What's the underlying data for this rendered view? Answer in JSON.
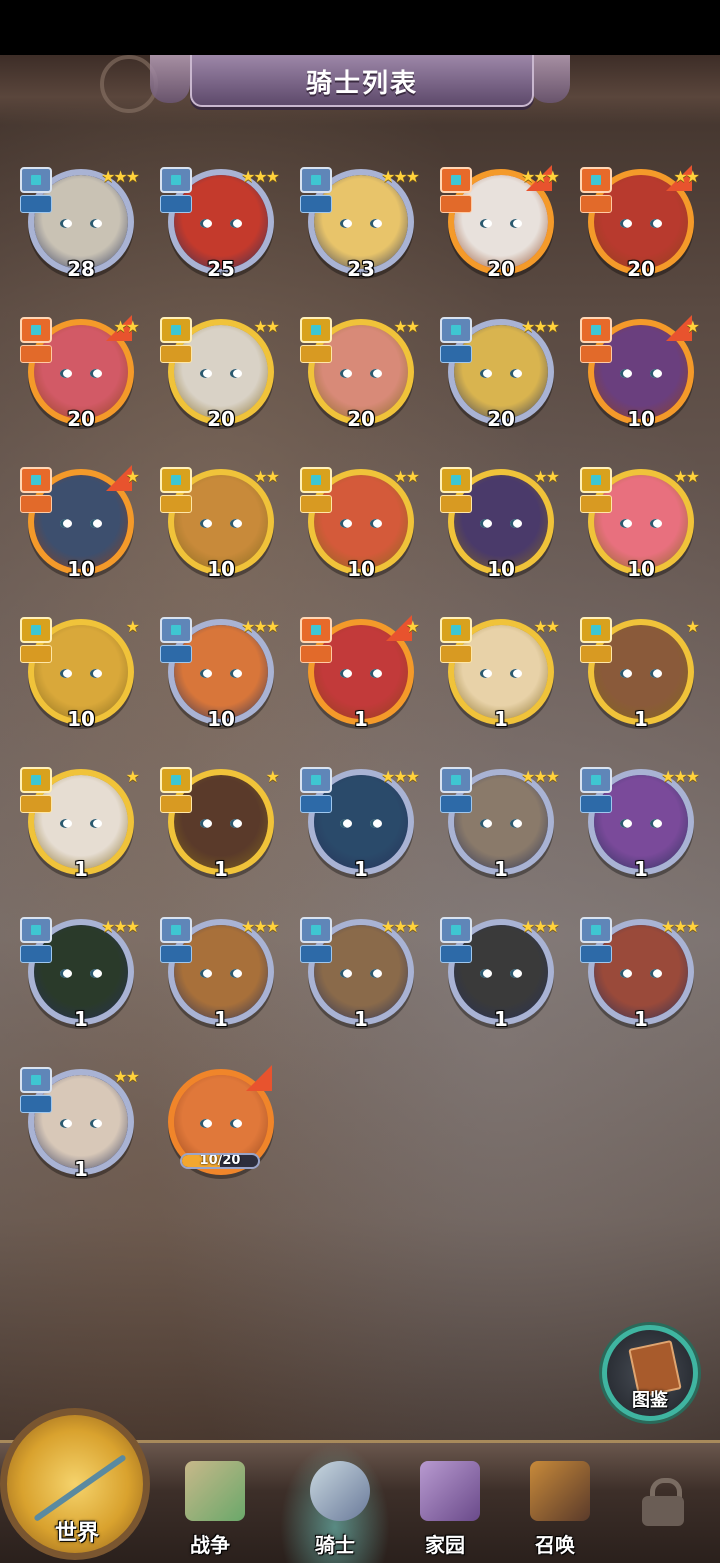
{
  "header": {
    "title": "骑士列表"
  },
  "knights": [
    {
      "level": "28",
      "stars": "★★★",
      "rarity": "blue",
      "flag": false,
      "face": "#c9c2b4"
    },
    {
      "level": "25",
      "stars": "★★★",
      "rarity": "blue",
      "flag": false,
      "face": "#c43a2c"
    },
    {
      "level": "23",
      "stars": "★★★",
      "rarity": "blue",
      "flag": false,
      "face": "#e8c46a"
    },
    {
      "level": "20",
      "stars": "★★★",
      "rarity": "orange",
      "flag": true,
      "face": "#e8e1dc"
    },
    {
      "level": "20",
      "stars": "★★",
      "rarity": "orange",
      "flag": true,
      "face": "#b83a2e"
    },
    {
      "level": "20",
      "stars": "★★",
      "rarity": "orange",
      "flag": true,
      "face": "#d25a66"
    },
    {
      "level": "20",
      "stars": "★★",
      "rarity": "gold",
      "flag": false,
      "face": "#d9d2c6"
    },
    {
      "level": "20",
      "stars": "★★",
      "rarity": "gold",
      "flag": false,
      "face": "#d88a78"
    },
    {
      "level": "20",
      "stars": "★★★",
      "rarity": "blue",
      "flag": false,
      "face": "#d9b44f"
    },
    {
      "level": "10",
      "stars": "★",
      "rarity": "orange",
      "flag": true,
      "face": "#6a3f7e"
    },
    {
      "level": "10",
      "stars": "★",
      "rarity": "orange",
      "flag": true,
      "face": "#3d4f6e"
    },
    {
      "level": "10",
      "stars": "★★",
      "rarity": "gold",
      "flag": false,
      "face": "#c88a3a"
    },
    {
      "level": "10",
      "stars": "★★",
      "rarity": "gold",
      "flag": false,
      "face": "#d45a3a"
    },
    {
      "level": "10",
      "stars": "★★",
      "rarity": "gold",
      "flag": false,
      "face": "#4a3a6a"
    },
    {
      "level": "10",
      "stars": "★★",
      "rarity": "gold",
      "flag": false,
      "face": "#e8707e"
    },
    {
      "level": "10",
      "stars": "★",
      "rarity": "gold",
      "flag": false,
      "face": "#d9a83a"
    },
    {
      "level": "10",
      "stars": "★★★",
      "rarity": "blue",
      "flag": false,
      "face": "#d8763a"
    },
    {
      "level": "1",
      "stars": "★",
      "rarity": "orange",
      "flag": true,
      "face": "#c23a3a"
    },
    {
      "level": "1",
      "stars": "★★",
      "rarity": "gold",
      "flag": false,
      "face": "#e8d2a8"
    },
    {
      "level": "1",
      "stars": "★",
      "rarity": "gold",
      "flag": false,
      "face": "#8a5a3a"
    },
    {
      "level": "1",
      "stars": "★",
      "rarity": "gold",
      "flag": false,
      "face": "#e6ddd2"
    },
    {
      "level": "1",
      "stars": "★",
      "rarity": "gold",
      "flag": false,
      "face": "#5a3a2a"
    },
    {
      "level": "1",
      "stars": "★★★",
      "rarity": "blue",
      "flag": false,
      "face": "#2a4a6a"
    },
    {
      "level": "1",
      "stars": "★★★",
      "rarity": "blue",
      "flag": false,
      "face": "#8a7a6a"
    },
    {
      "level": "1",
      "stars": "★★★",
      "rarity": "blue",
      "flag": false,
      "face": "#7a4a9a"
    },
    {
      "level": "1",
      "stars": "★★★",
      "rarity": "blue",
      "flag": false,
      "face": "#2a3a2a"
    },
    {
      "level": "1",
      "stars": "★★★",
      "rarity": "blue",
      "flag": false,
      "face": "#a8703a"
    },
    {
      "level": "1",
      "stars": "★★★",
      "rarity": "blue",
      "flag": false,
      "face": "#8a6a4a"
    },
    {
      "level": "1",
      "stars": "★★★",
      "rarity": "blue",
      "flag": false,
      "face": "#3a3a3a"
    },
    {
      "level": "1",
      "stars": "★★★",
      "rarity": "blue",
      "flag": false,
      "face": "#9a4a3a"
    },
    {
      "level": "1",
      "stars": "★★",
      "rarity": "blue",
      "flag": false,
      "face": "#d8c8b8"
    }
  ],
  "shard_knight": {
    "progress_text": "10/20",
    "fraction": 0.5,
    "face": "#e0783a"
  },
  "compendium": {
    "label": "图鉴"
  },
  "nav": {
    "world": "世界",
    "war": "战争",
    "knight": "骑士",
    "home": "家园",
    "summon": "召唤"
  }
}
